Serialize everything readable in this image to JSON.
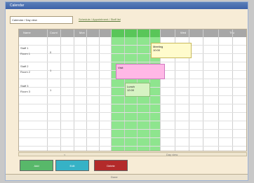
{
  "window": {
    "title": "Calendar"
  },
  "toolbar": {
    "tab_active": "Calendar / Day view",
    "link_text": "Schedule / Appointment / Staff list"
  },
  "grid": {
    "headers": [
      "Name",
      "Count",
      "Mon",
      "Tue",
      "Wed",
      "Thu",
      "Fri"
    ],
    "rows": [
      {
        "label": "Staff 1",
        "subtitle": "Room 1",
        "count": "0"
      },
      {
        "label": "Staff 2",
        "subtitle": "Room 2",
        "count": "1"
      },
      {
        "label": "Staff 3",
        "subtitle": "Room 3",
        "count": "1"
      }
    ],
    "events": {
      "yellow": {
        "title": "Meeting",
        "detail": "10:00"
      },
      "pink": {
        "title": "Visit"
      },
      "green": {
        "title": "Lunch",
        "detail": "12:00"
      }
    }
  },
  "scrollbar": {
    "left_label": "<",
    "right_label": "Day view"
  },
  "buttons": {
    "a": "Add",
    "b": "Edit",
    "c": "Delete"
  },
  "status": {
    "text": "Done"
  }
}
